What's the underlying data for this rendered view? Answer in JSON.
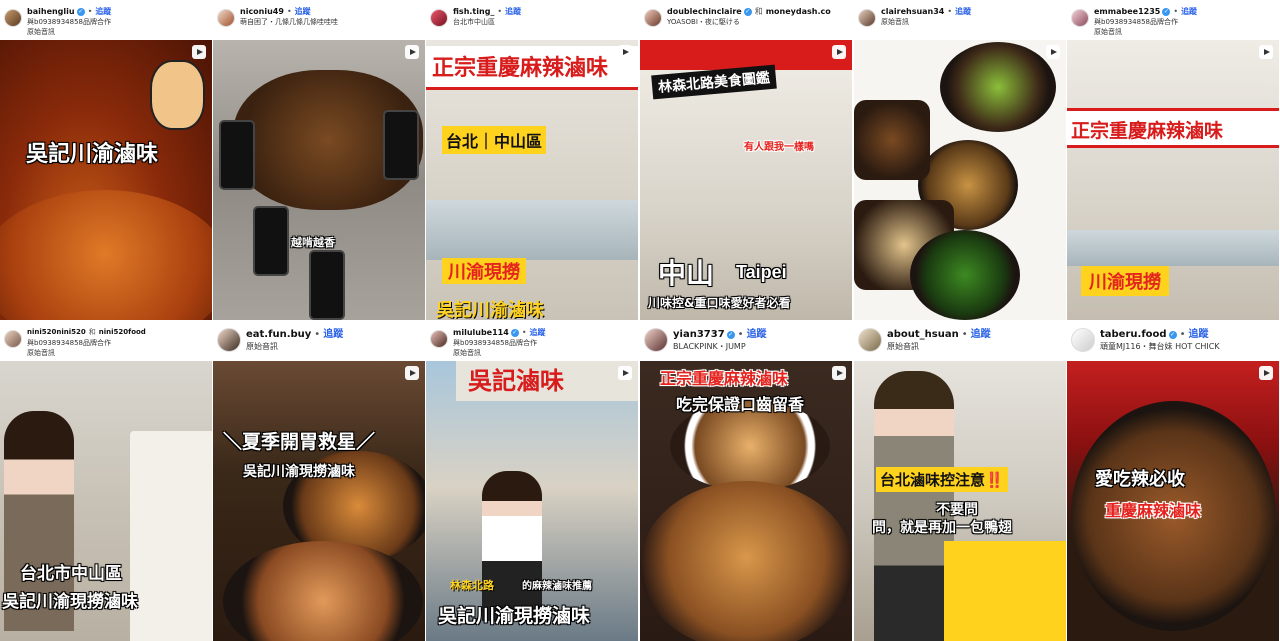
{
  "follow_label": "追蹤",
  "posts": [
    {
      "username": "baihengliu",
      "verified": true,
      "subtitle": "與b0938934858品牌合作",
      "audio": "原始音訊",
      "overlays": [
        "吳記川渝滷味"
      ]
    },
    {
      "username": "niconiu49",
      "verified": false,
      "subtitle": "萌自困了・几條几條几條哇哇哇",
      "audio": "",
      "overlays": [
        "越啃越香"
      ]
    },
    {
      "username": "fish.ting_",
      "verified": false,
      "subtitle": "台北市中山區",
      "audio": "",
      "overlays": [
        "台北｜中山區",
        "正宗重慶麻辣滷味",
        "川渝現撈",
        "吳記川渝滷味"
      ]
    },
    {
      "username": "doublechinclaire",
      "verified": true,
      "subtitle_extra_user": "moneydash.co",
      "subtitle_and": "和",
      "subtitle": "YOASOBI・夜に駆ける",
      "audio": "",
      "overlays": [
        "林森北路美食圖鑑",
        "有人跟我一樣嗎",
        "中山",
        "Taipei",
        "川味控&重口味愛好者必看"
      ]
    },
    {
      "username": "clairehsuan34",
      "verified": false,
      "subtitle": "原始音訊",
      "audio": "",
      "overlays": []
    },
    {
      "username": "emmabee1235",
      "verified": true,
      "subtitle": "與b0938934858品牌合作",
      "audio": "原始音訊",
      "overlays": [
        "正宗重慶麻辣滷味",
        "川渝現撈"
      ]
    },
    {
      "username": "nini520nini520",
      "verified": false,
      "subtitle_and": "和",
      "subtitle_extra_user": "nini520food",
      "subtitle": "與b0938934858品牌合作",
      "audio": "原始音訊",
      "overlays": [
        "台北市中山區",
        "吳記川渝現撈滷味"
      ]
    },
    {
      "username": "eat.fun.buy",
      "verified": false,
      "subtitle": "原始音訊",
      "audio": "",
      "overlays": [
        "＼夏季開胃救星／",
        "吳記川渝現撈滷味"
      ]
    },
    {
      "username": "milulube114",
      "verified": true,
      "subtitle": "與b0938934858品牌合作",
      "audio": "原始音訊",
      "overlays": [
        "吳記滷味",
        "林森北路",
        "的麻辣滷味推薦",
        "吳記川渝現撈滷味"
      ]
    },
    {
      "username": "yian3737",
      "verified": true,
      "subtitle": "BLACKPINK・JUMP",
      "audio": "",
      "overlays": [
        "正宗重慶麻辣滷味",
        "吃完保證口齒留香"
      ]
    },
    {
      "username": "about_hsuan",
      "verified": false,
      "subtitle": "原始音訊",
      "audio": "",
      "overlays": [
        "台北滷味控注意‼️",
        "不要問",
        "問，就是再加一包鴨翅"
      ]
    },
    {
      "username": "taberu.food",
      "verified": true,
      "subtitle": "頑童MJ116・舞台妹 HOT CHICK",
      "audio": "",
      "overlays": [
        "愛吃辣必收",
        "重慶麻辣滷味"
      ]
    }
  ],
  "colors": {
    "follow": "#2a62e8",
    "verified": "#3897f0",
    "accent_red": "#e5231e",
    "accent_yellow": "#ffd21e"
  },
  "icons": [
    "reel-icon",
    "verified-badge-icon"
  ]
}
